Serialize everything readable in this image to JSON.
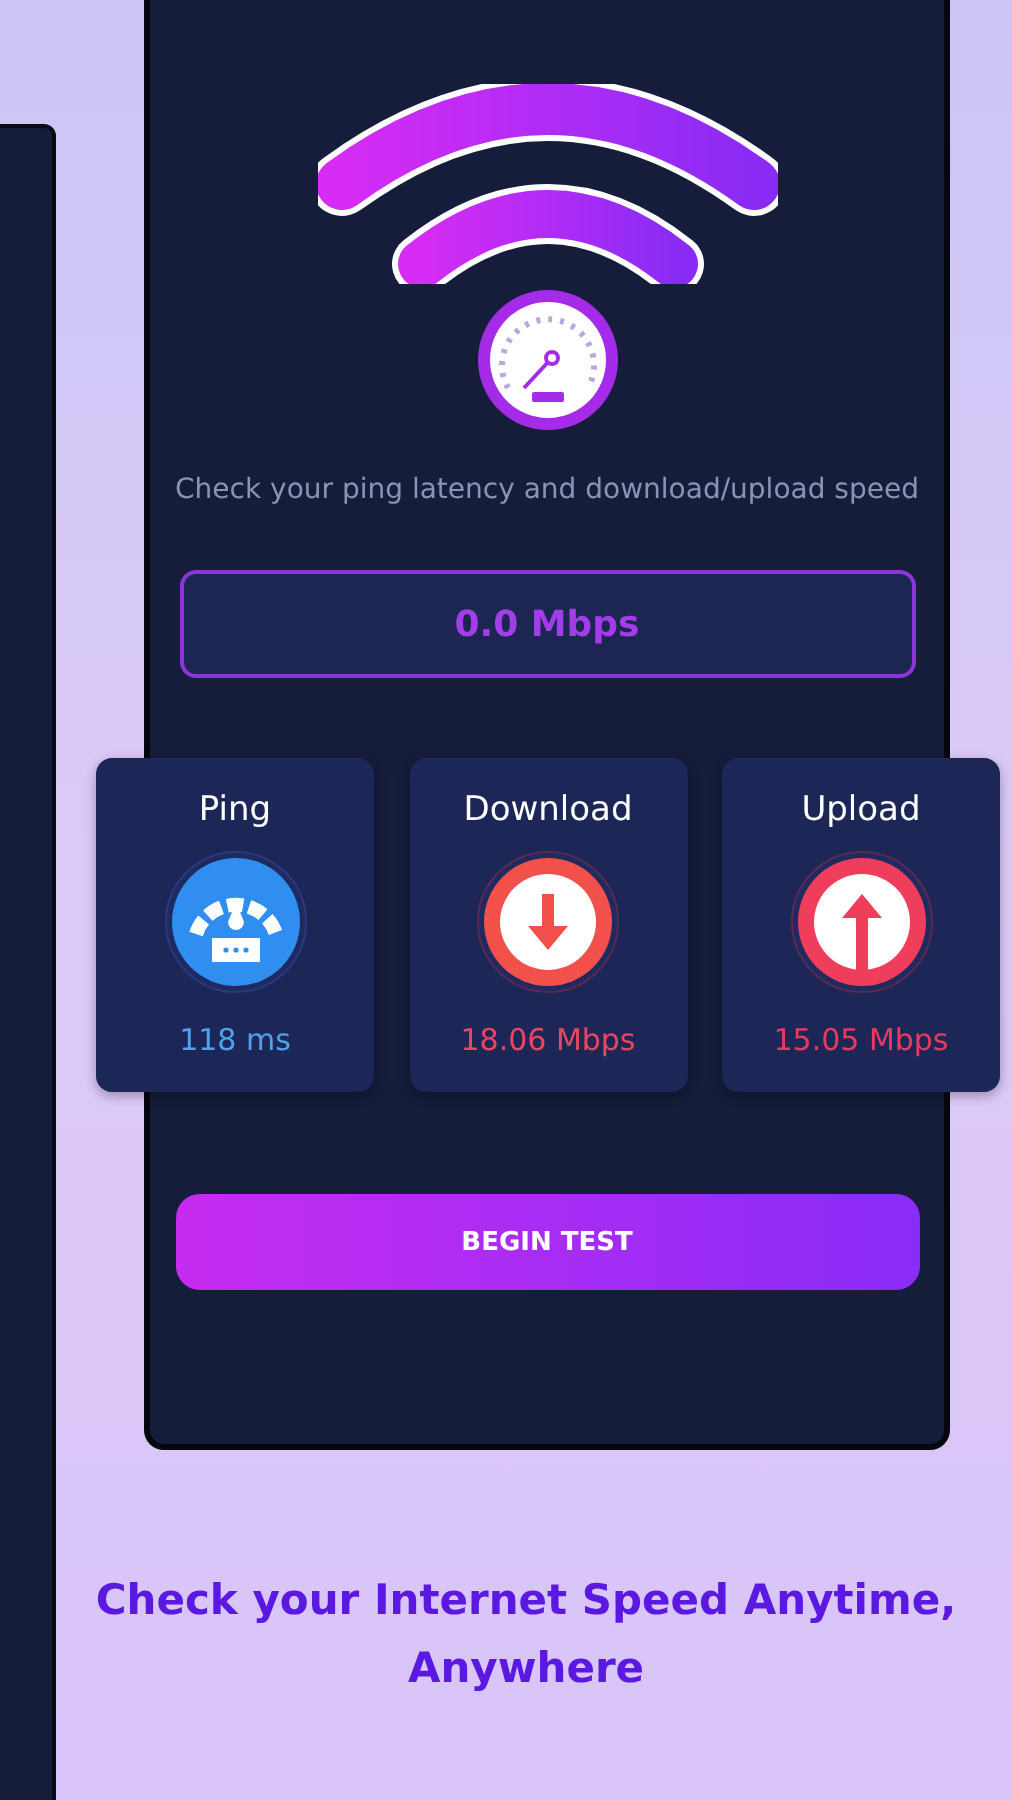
{
  "description": "Check your ping latency and download/upload speed",
  "speed_display": "0.0 Mbps",
  "metrics": [
    {
      "kind": "ping",
      "label": "Ping",
      "value": "118 ms",
      "color": "#4ea3ea"
    },
    {
      "kind": "download",
      "label": "Download",
      "value": "18.06 Mbps",
      "color": "#e8475f"
    },
    {
      "kind": "upload",
      "label": "Upload",
      "value": "15.05 Mbps",
      "color": "#e83a5f"
    }
  ],
  "button": "BEGIN TEST",
  "tagline": "Check your Internet Speed Anytime, Anywhere"
}
